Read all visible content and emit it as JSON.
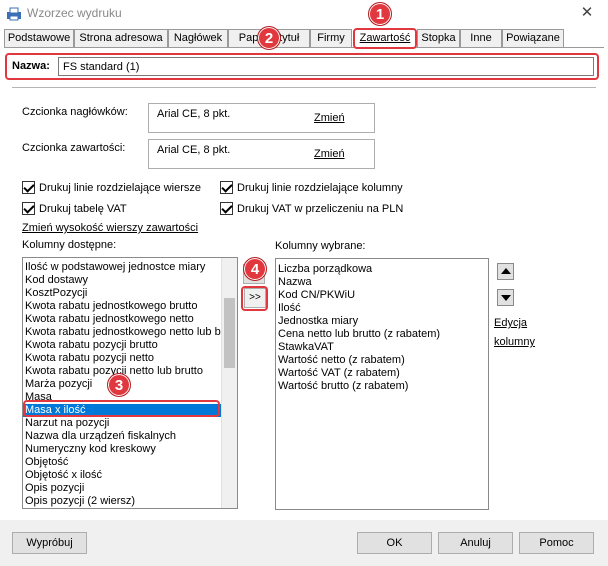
{
  "window": {
    "title": "Wzorzec wydruku",
    "close_symbol": "✕",
    "icon": "printer-template-icon"
  },
  "tabs": [
    {
      "label": "Podstawowe",
      "active": false
    },
    {
      "label": "Strona adresowa",
      "active": false
    },
    {
      "label": "Nagłówek",
      "active": false
    },
    {
      "label": "Papier i tytuł",
      "active": false
    },
    {
      "label": "Firmy",
      "active": false
    },
    {
      "label": "Zawartość",
      "active": true
    },
    {
      "label": "Stopka",
      "active": false
    },
    {
      "label": "Inne",
      "active": false
    },
    {
      "label": "Powiązane",
      "active": false
    }
  ],
  "name_field": {
    "label": "Nazwa:",
    "value": "FS standard (1)"
  },
  "fonts": {
    "header_label": "Czcionka nagłówków:",
    "header_value": "Arial CE, 8 pkt.",
    "header_change": "Zmień",
    "content_label": "Czcionka zawartości:",
    "content_value": "Arial CE, 8 pkt.",
    "content_change": "Zmień"
  },
  "checkboxes": [
    {
      "label": "Drukuj linie rozdzielające wiersze",
      "checked": true
    },
    {
      "label": "Drukuj linie rozdzielające kolumny",
      "checked": true
    },
    {
      "label": "Drukuj tabelę VAT",
      "checked": true
    },
    {
      "label": "Drukuj VAT w przeliczeniu na PLN",
      "checked": true
    }
  ],
  "row_height_link": "Zmień wysokość wierszy zawartości",
  "available": {
    "label": "Kolumny dostępne:",
    "items": [
      "Ilość w podstawowej jednostce miary",
      "Kod dostawy",
      "KosztPozycji",
      "Kwota rabatu jednostkowego brutto",
      "Kwota rabatu jednostkowego netto",
      "Kwota rabatu jednostkowego netto lub brutto",
      "Kwota rabatu pozycji brutto",
      "Kwota rabatu pozycji netto",
      "Kwota rabatu pozycji netto lub brutto",
      "Marża pozycji",
      "Masa",
      "Masa x ilość",
      "Narzut na pozycji",
      "Nazwa dla urządzeń fiskalnych",
      "Numeryczny kod kreskowy",
      "Objętość",
      "Objętość x ilość",
      "Opis pozycji",
      "Opis pozycji (2 wiersz)"
    ],
    "selected": "Masa x ilość"
  },
  "transfer": {
    "remove_label": "<<",
    "add_label": ">>"
  },
  "chosen": {
    "label": "Kolumny wybrane:",
    "items": [
      "Liczba porządkowa",
      "Nazwa",
      "Kod CN/PKWiU",
      "Ilość",
      "Jednostka miary",
      "Cena netto lub brutto (z rabatem)",
      "StawkaVAT",
      "Wartość netto (z rabatem)",
      "Wartość VAT (z rabatem)",
      "Wartość brutto (z rabatem)"
    ]
  },
  "edit_column": {
    "line1": "Edycja",
    "line2": "kolumny"
  },
  "buttons": {
    "try": "Wypróbuj",
    "ok": "OK",
    "cancel": "Anuluj",
    "help": "Pomoc"
  },
  "callouts": [
    "1",
    "2",
    "3",
    "4"
  ],
  "colors": {
    "highlight": "#e0383e",
    "selection": "#0078d7"
  }
}
